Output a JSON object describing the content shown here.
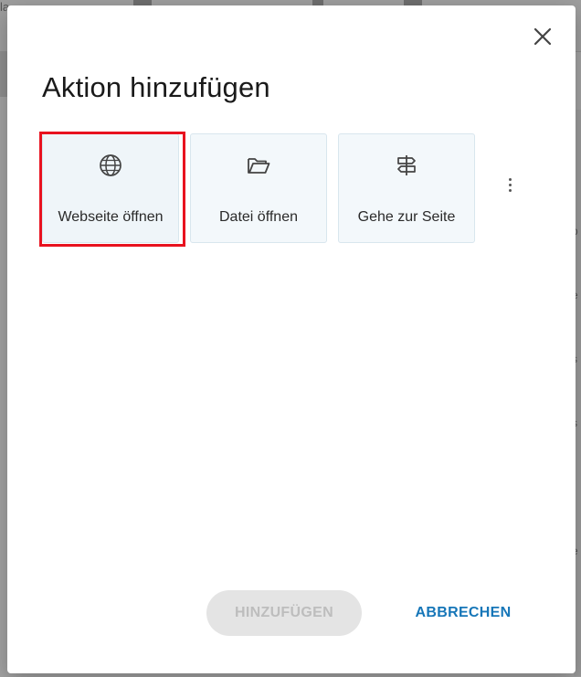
{
  "dialog": {
    "title": "Aktion hinzufügen",
    "close_icon": "close-icon",
    "more_icon": "more-vertical-icon"
  },
  "tiles": [
    {
      "label": "Webseite öffnen",
      "icon": "globe-icon",
      "selected": true
    },
    {
      "label": "Datei öffnen",
      "icon": "folder-open-icon",
      "selected": false
    },
    {
      "label": "Gehe zur Seite",
      "icon": "signpost-icon",
      "selected": false
    }
  ],
  "buttons": {
    "add_label": "HINZUFÜGEN",
    "cancel_label": "ABBRECHEN"
  },
  "colors": {
    "highlight": "#e8121f",
    "accent": "#1676b8",
    "tile_bg": "#f3f8fb"
  },
  "background": {
    "right_edge_texts": [
      "p",
      "e",
      "s",
      "s",
      "e"
    ],
    "top_left_text": "la"
  }
}
